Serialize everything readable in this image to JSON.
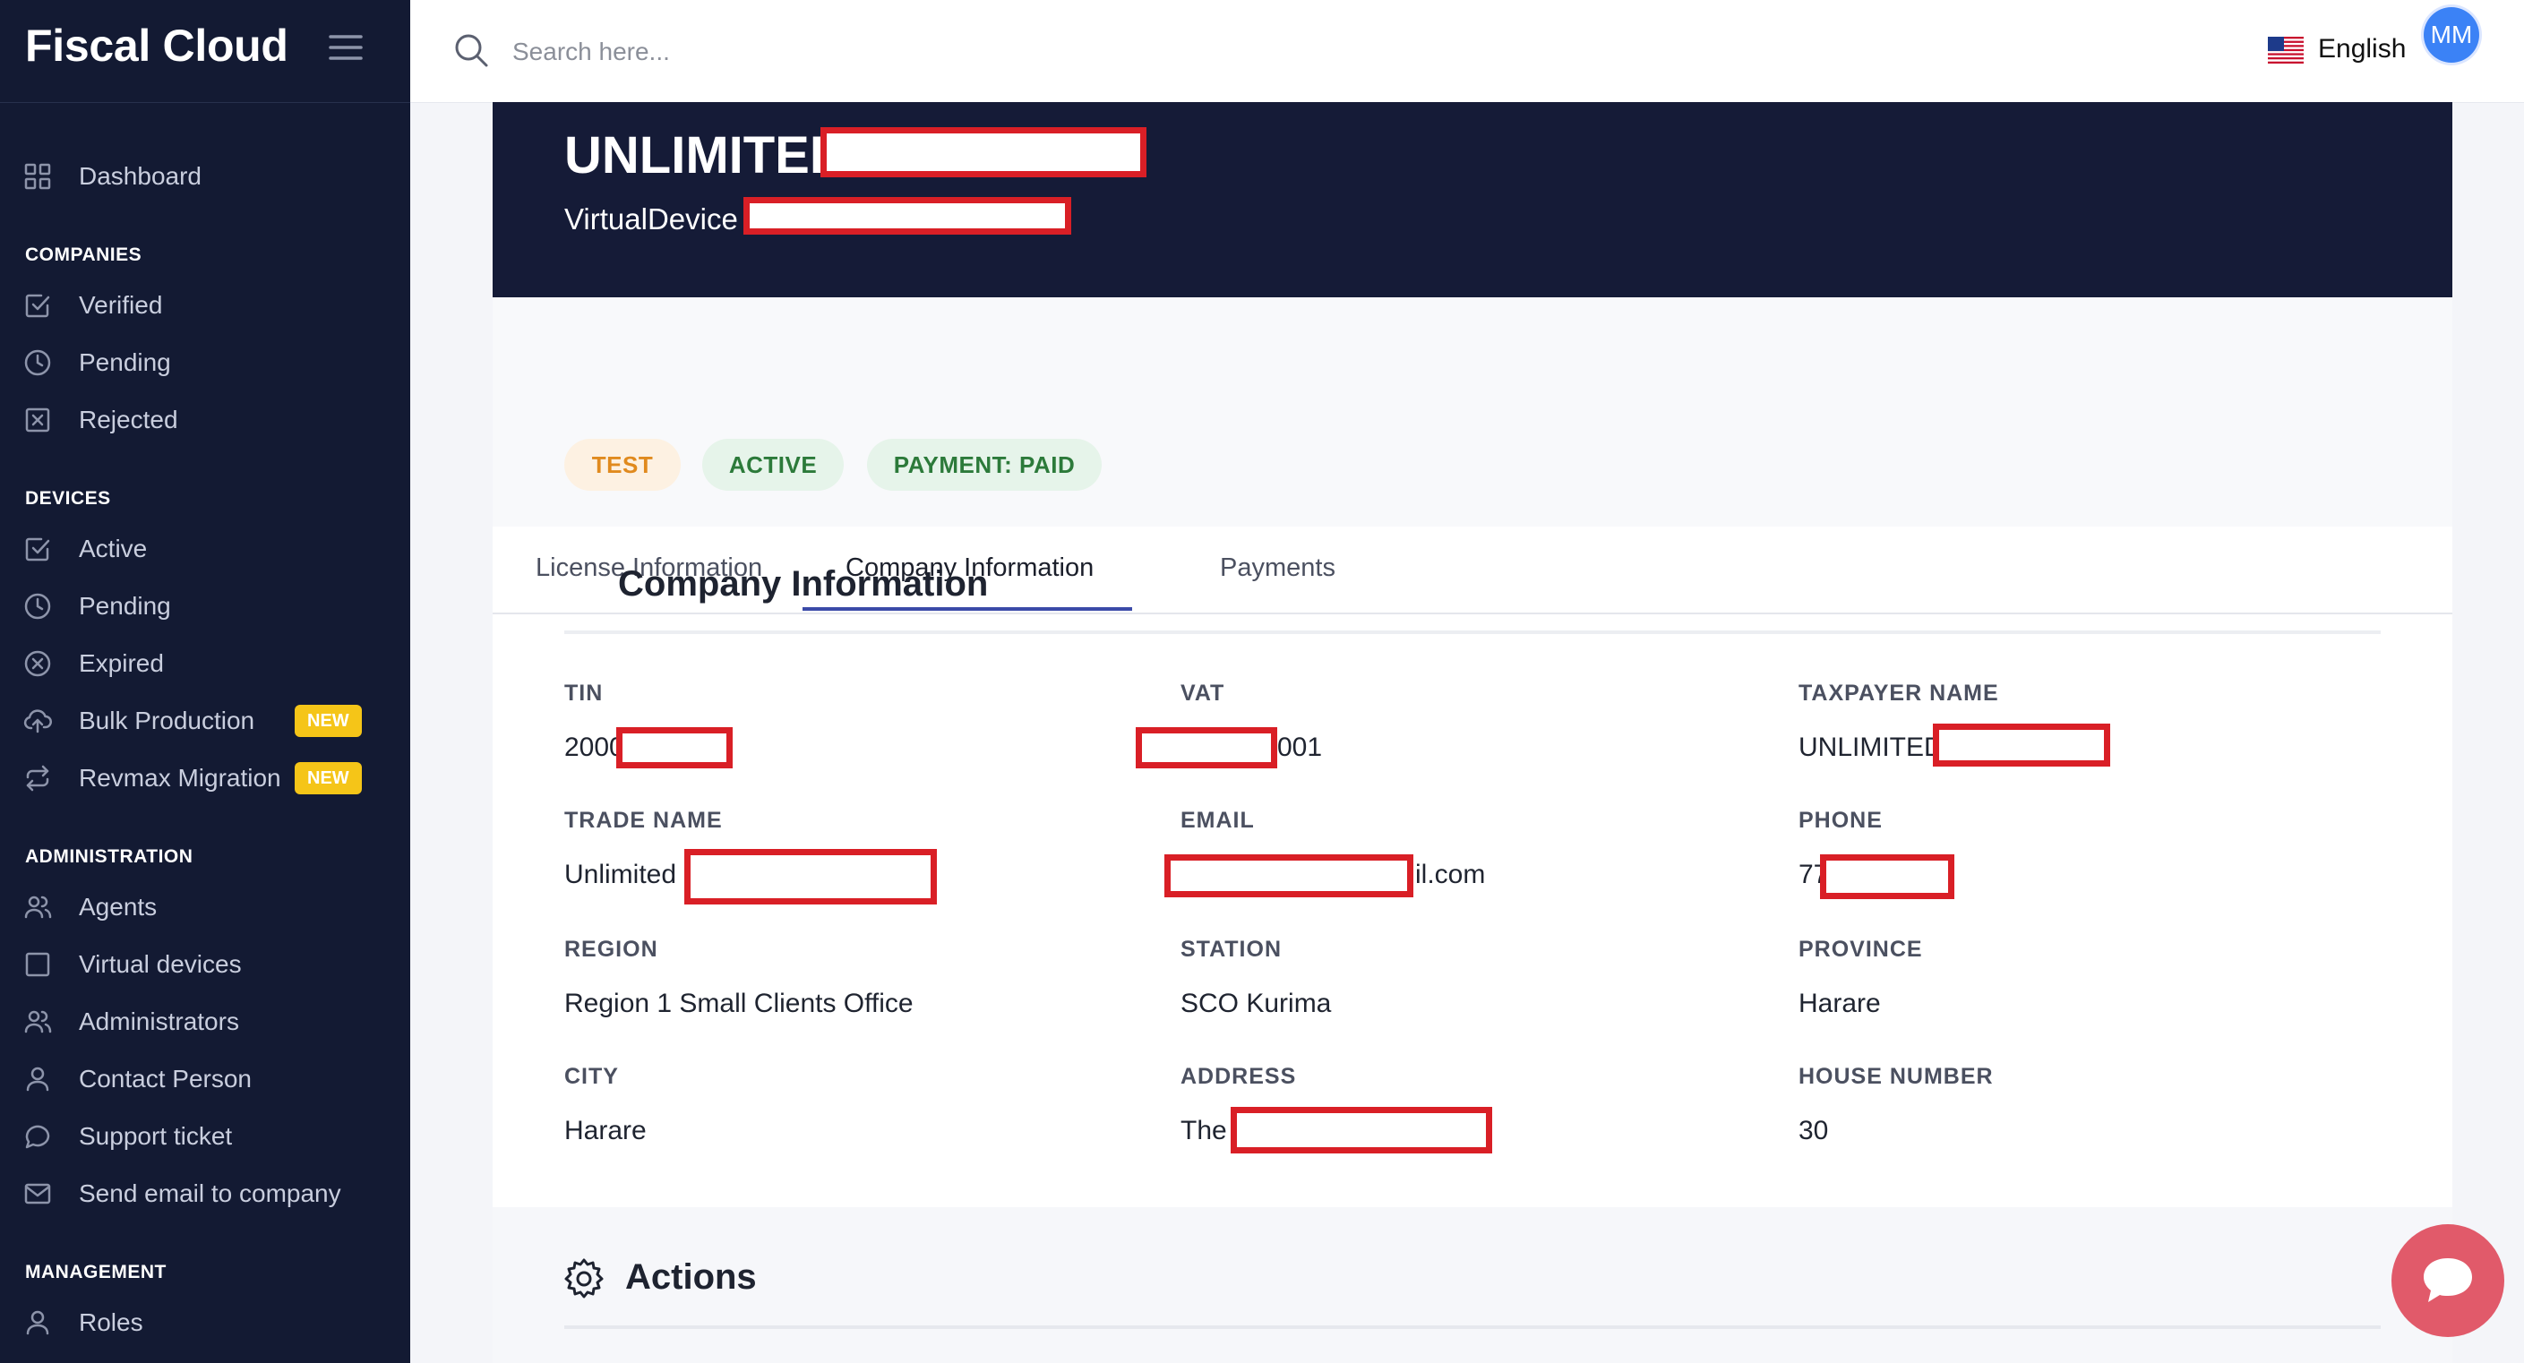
{
  "app": {
    "brand": "Fiscal Cloud"
  },
  "sidebar": {
    "dashboard": "Dashboard",
    "sections": {
      "companies": "COMPANIES",
      "devices": "DEVICES",
      "administration": "ADMINISTRATION",
      "management": "MANAGEMENT"
    },
    "companies": [
      "Verified",
      "Pending",
      "Rejected"
    ],
    "devices": [
      "Active",
      "Pending",
      "Expired",
      "Bulk Production",
      "Revmax Migration"
    ],
    "new_badge": "NEW",
    "administration": [
      "Agents",
      "Virtual devices",
      "Administrators",
      "Contact Person",
      "Support ticket",
      "Send email to company"
    ],
    "management": [
      "Roles"
    ]
  },
  "topbar": {
    "search_placeholder": "Search here...",
    "language": "English",
    "avatar_initials": "MM"
  },
  "device": {
    "title": "UNLIMITED",
    "subtitle": "VirtualDevice -",
    "chips": [
      "TEST",
      "ACTIVE",
      "PAYMENT: PAID"
    ]
  },
  "tabs": [
    "License Information",
    "Company Information",
    "Payments"
  ],
  "active_tab": "Company Information",
  "company_info": {
    "heading": "Company Information",
    "fields": [
      {
        "label": "TIN",
        "value": "2000"
      },
      {
        "label": "VAT",
        "value": "001"
      },
      {
        "label": "TAXPAYER NAME",
        "value": "UNLIMITED"
      },
      {
        "label": "TRADE NAME",
        "value": "Unlimited"
      },
      {
        "label": "EMAIL",
        "value": "il.com"
      },
      {
        "label": "PHONE",
        "value": "77"
      },
      {
        "label": "REGION",
        "value": "Region 1 Small Clients Office"
      },
      {
        "label": "STATION",
        "value": "SCO Kurima"
      },
      {
        "label": "PROVINCE",
        "value": "Harare"
      },
      {
        "label": "CITY",
        "value": "Harare"
      },
      {
        "label": "ADDRESS",
        "value": "The"
      },
      {
        "label": "HOUSE NUMBER",
        "value": "30"
      }
    ]
  },
  "actions": {
    "heading": "Actions"
  },
  "colors": {
    "sidebar_bg": "#131a33",
    "hero_bg": "#151b37",
    "redaction": "#d91f26",
    "badge_new": "#f5c518",
    "chat_fab": "#e15a6a",
    "tab_underline": "#3b4aa8"
  },
  "icons": {
    "menu": "hamburger-icon",
    "search": "search-icon",
    "flag": "us-flag-icon",
    "chat": "chat-bubble-icon",
    "gear": "gear-icon"
  }
}
